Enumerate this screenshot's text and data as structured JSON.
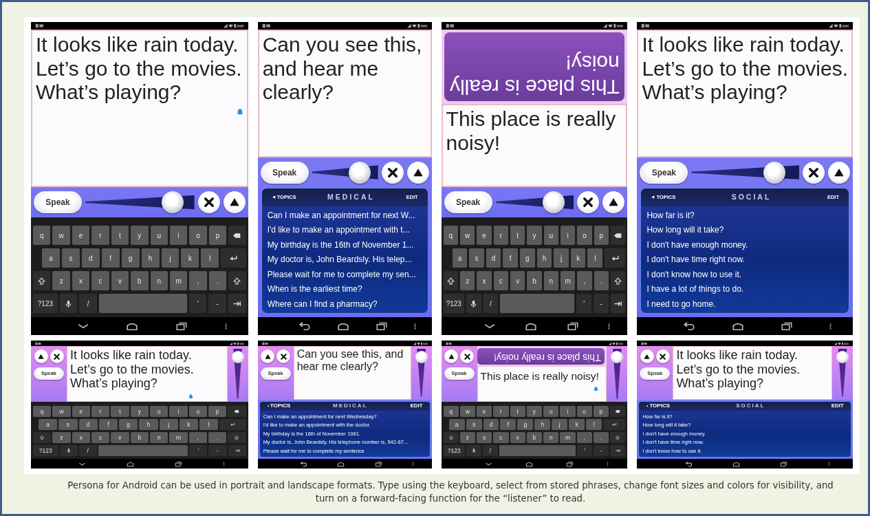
{
  "screens": [
    {
      "kind": "portrait",
      "message": "It looks like rain today.\nLet’s go to the movies.\nWhat’s playing?",
      "cursor": true,
      "speak": "Speak",
      "level": 0.88,
      "keyboard": [
        [
          "q",
          "w",
          "e",
          "r",
          "t",
          "y",
          "u",
          "i",
          "o",
          "p"
        ],
        [
          "a",
          "s",
          "d",
          "f",
          "g",
          "h",
          "j",
          "k",
          "l"
        ],
        [
          "z",
          "x",
          "c",
          "v",
          "b",
          "n",
          "m",
          ",",
          "."
        ],
        [
          "?123",
          "/",
          "'",
          "-"
        ]
      ]
    },
    {
      "kind": "portrait",
      "message": "Can you see this,\nand hear me\nclearly?",
      "cursor": false,
      "speak": "Speak",
      "level": 0.84,
      "phrases": {
        "topics": "TOPICS",
        "title": "MEDICAL",
        "edit": "EDIT",
        "items": [
          "Can I make an appointment for next W...",
          "I'd like to make an appointment with t...",
          "My birthday is the 16th of November 1...",
          "My doctor is, John Beardsly. His telep...",
          "Please wait for me to complete my sen...",
          "When is the earliest time?",
          "Where can I find a pharmacy?"
        ]
      }
    },
    {
      "kind": "portrait",
      "flipped_text": "This place is really\nnoisy!",
      "message": "This place is really\nnoisy!",
      "cursor": false,
      "speak": "Speak",
      "level": 0.84,
      "keyboard": [
        [
          "q",
          "w",
          "e",
          "r",
          "t",
          "y",
          "u",
          "i",
          "o",
          "p"
        ],
        [
          "a",
          "s",
          "d",
          "f",
          "g",
          "h",
          "j",
          "k",
          "l"
        ],
        [
          "z",
          "x",
          "c",
          "v",
          "b",
          "n",
          "m",
          ",",
          "."
        ],
        [
          "?123",
          "/",
          "'",
          "-"
        ]
      ]
    },
    {
      "kind": "portrait",
      "message": "It looks like rain today.\nLet’s go to the movies.\nWhat’s playing?",
      "cursor": false,
      "speak": "Speak",
      "level": 0.84,
      "phrases": {
        "topics": "TOPICS",
        "title": "SOCIAL",
        "edit": "EDIT",
        "items": [
          "How far is it?",
          "How long will it take?",
          "I don't have enough money.",
          "I don't have time right now.",
          "I don't know how to use it.",
          "I have a lot of things to do.",
          "I need to go home."
        ]
      }
    },
    {
      "kind": "landscape",
      "message": "It looks like rain today.\nLet’s go to the movies.\nWhat’s playing?",
      "cursor": true,
      "speak": "Speak",
      "level": 0.95,
      "keyboard": [
        [
          "q",
          "w",
          "e",
          "r",
          "t",
          "y",
          "u",
          "i",
          "o",
          "p"
        ],
        [
          "a",
          "s",
          "d",
          "f",
          "g",
          "h",
          "j",
          "k",
          "l"
        ],
        [
          "z",
          "x",
          "c",
          "v",
          "b",
          "n",
          "m",
          ",",
          "."
        ],
        [
          "?123",
          "/",
          "'",
          "-"
        ]
      ]
    },
    {
      "kind": "landscape",
      "message": "Can you see this, and\nhear me clearly?",
      "cursor": false,
      "speak": "Speak",
      "level": 0.95,
      "phrases": {
        "topics": "TOPICS",
        "title": "MEDICAL",
        "edit": "EDIT",
        "items": [
          "Can I make an appointment for next Wednesday?",
          "I'd like to make an appointment with the doctor.",
          "My birthday is the 16th of November 1961.",
          "My doctor is, John Beardsly. His telephone number is, 542-67...",
          "Please wait for me to complete my sentence"
        ]
      }
    },
    {
      "kind": "landscape",
      "flipped_text": "This place is really noisy!",
      "message": "This place is really noisy!",
      "cursor": true,
      "speak": "Speak",
      "level": 0.95,
      "keyboard": [
        [
          "q",
          "w",
          "e",
          "r",
          "t",
          "y",
          "u",
          "i",
          "o",
          "p"
        ],
        [
          "a",
          "s",
          "d",
          "f",
          "g",
          "h",
          "j",
          "k",
          "l"
        ],
        [
          "z",
          "x",
          "c",
          "v",
          "b",
          "n",
          "m",
          ",",
          "."
        ],
        [
          "?123",
          "/",
          "'",
          "-"
        ]
      ]
    },
    {
      "kind": "landscape",
      "message": "It looks like rain today.\nLet’s go to the movies.\nWhat’s playing?",
      "cursor": false,
      "speak": "Speak",
      "level": 0.95,
      "phrases": {
        "topics": "TOPICS",
        "title": "SOCIAL",
        "edit": "EDIT",
        "items": [
          "How far is it?",
          "How long will it take?",
          "I don't have enough money.",
          "I don't have time right now.",
          "I don't know how to use it."
        ]
      }
    }
  ],
  "caption": "Persona for Android can be used in portrait and landscape formats. Type using the keyboard, select from stored phrases, change font sizes and colors for visibility, and turn on a forward-facing function for the “listener” to read."
}
